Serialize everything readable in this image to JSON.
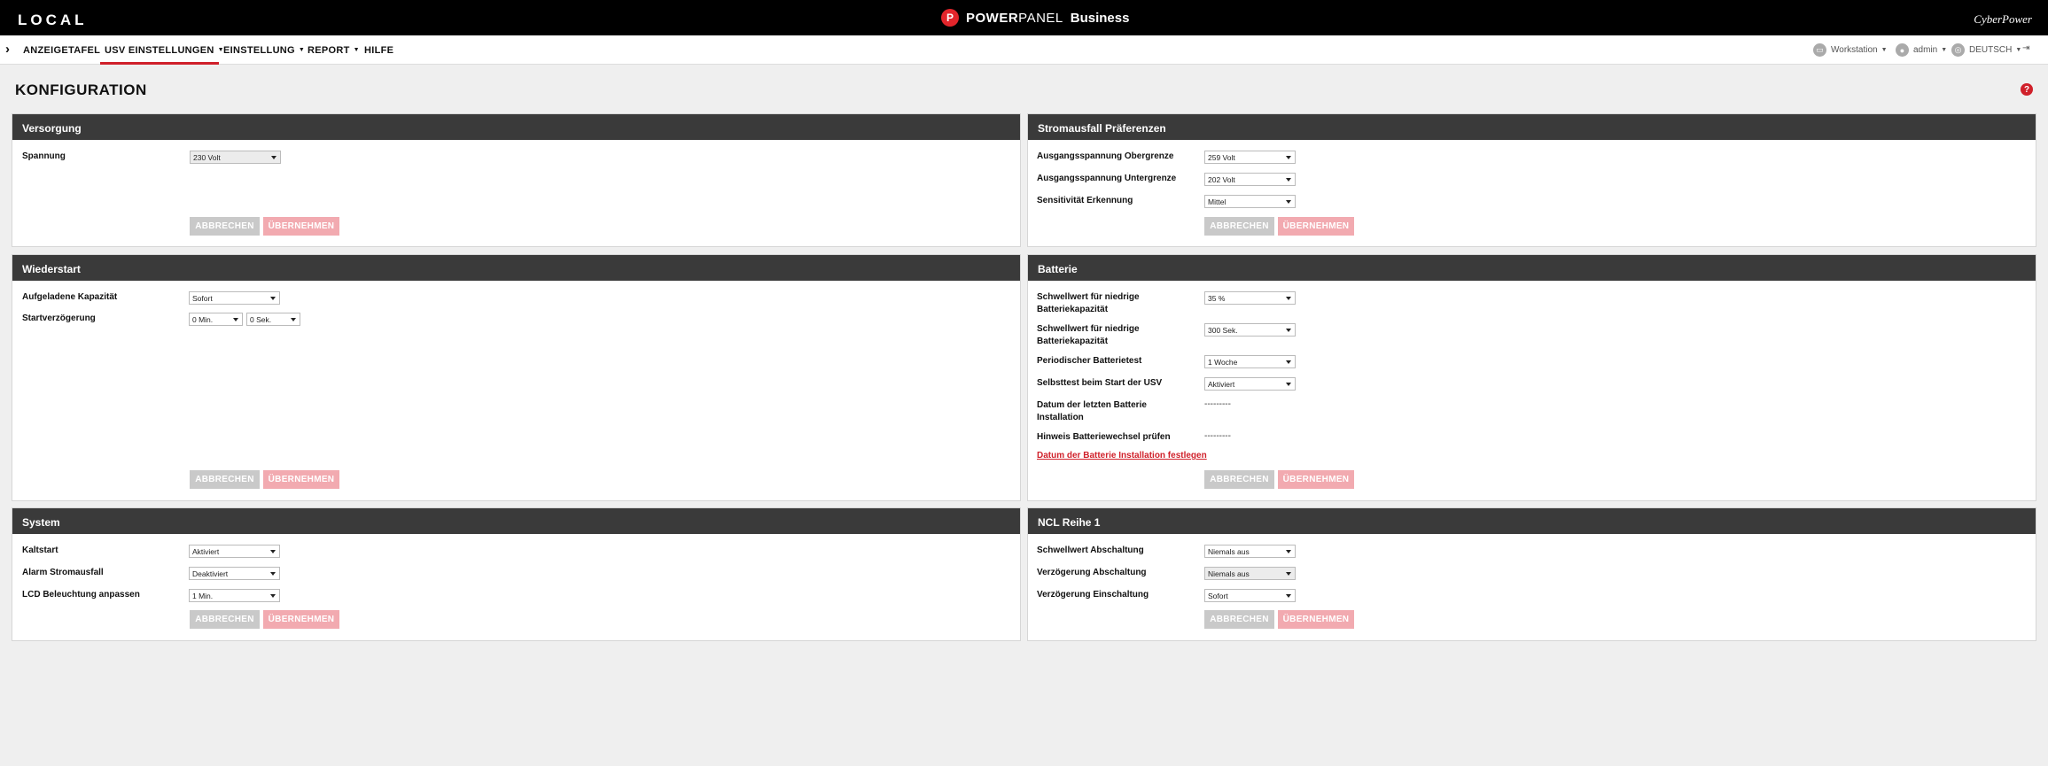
{
  "topbar": {
    "location": "LOCAL",
    "logo_glyph": "P",
    "brand_bold": "POWER",
    "brand_rest": "PANEL",
    "brand_suffix": "Business",
    "vendor": "CyberPower"
  },
  "nav": {
    "items": [
      "ANZEIGETAFEL",
      "USV EINSTELLUNGEN",
      "EINSTELLUNG",
      "REPORT",
      "HILFE"
    ],
    "active_index": 1,
    "workstation": "Workstation",
    "user": "admin",
    "language": "DEUTSCH"
  },
  "page_title": "KONFIGURATION",
  "buttons": {
    "cancel": "ABBRECHEN",
    "apply": "ÜBERNEHMEN"
  },
  "versorgung": {
    "title": "Versorgung",
    "spannung_label": "Spannung",
    "spannung_value": "230 Volt"
  },
  "stromausfall": {
    "title": "Stromausfall Präferenzen",
    "ober_label": "Ausgangsspannung Obergrenze",
    "ober_value": "259 Volt",
    "unter_label": "Ausgangsspannung Untergrenze",
    "unter_value": "202 Volt",
    "sens_label": "Sensitivität Erkennung",
    "sens_value": "Mittel"
  },
  "wiederstart": {
    "title": "Wiederstart",
    "kap_label": "Aufgeladene Kapazität",
    "kap_value": "Sofort",
    "verz_label": "Startverzögerung",
    "verz_min": "0 Min.",
    "verz_sek": "0 Sek."
  },
  "batterie": {
    "title": "Batterie",
    "low_cap1_label_1": "Schwellwert für niedrige",
    "low_cap1_label_2": "Batteriekapazität",
    "low_cap1_value": "35 %",
    "low_cap2_label_1": "Schwellwert für niedrige",
    "low_cap2_label_2": "Batteriekapazität",
    "low_cap2_value": "300 Sek.",
    "periodic_label": "Periodischer Batterietest",
    "periodic_value": "1 Woche",
    "selftest_label": "Selbsttest beim Start der USV",
    "selftest_value": "Aktiviert",
    "install_label_1": "Datum der letzten Batterie",
    "install_label_2": "Installation",
    "install_value": "---------",
    "hint_label": "Hinweis Batteriewechsel prüfen",
    "hint_value": "---------",
    "set_link": "Datum der Batterie Installation festlegen"
  },
  "system": {
    "title": "System",
    "kalt_label": "Kaltstart",
    "kalt_value": "Aktiviert",
    "alarm_label": "Alarm Stromausfall",
    "alarm_value": "Deaktiviert",
    "lcd_label": "LCD Beleuchtung anpassen",
    "lcd_value": "1 Min."
  },
  "ncl": {
    "title": "NCL Reihe 1",
    "abs_label": "Schwellwert Abschaltung",
    "abs_value": "Niemals aus",
    "verz_abs_label": "Verzögerung Abschaltung",
    "verz_abs_value": "Niemals aus",
    "verz_ein_label": "Verzögerung Einschaltung",
    "verz_ein_value": "Sofort"
  }
}
